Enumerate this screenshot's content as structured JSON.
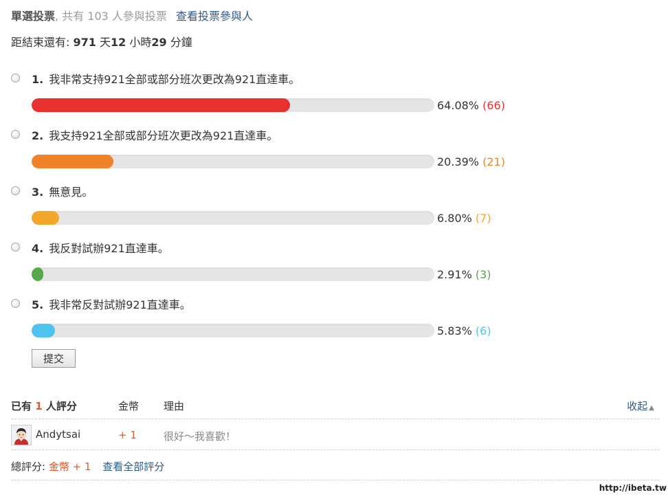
{
  "poll": {
    "type_label": "單選投票",
    "sep": ",",
    "participants_prefix": " 共有 ",
    "participants_count": "103",
    "participants_suffix": " 人參與投票",
    "view_voters_link": "查看投票參與人"
  },
  "countdown": {
    "prefix": "距結束還有: ",
    "days": "971",
    "days_unit": " 天",
    "hours": "12",
    "hours_unit": " 小時",
    "minutes": "29",
    "minutes_unit": " 分鐘"
  },
  "options": [
    {
      "num": "1.",
      "text": "我非常支持921全部或部分班次更改為921直達車。",
      "percent_label": "64.08%",
      "percent": 64.08,
      "votes_label": "(66)",
      "color": "#e8302e"
    },
    {
      "num": "2.",
      "text": "我支持921全部或部分班次更改為921直達車。",
      "percent_label": "20.39%",
      "percent": 20.39,
      "votes_label": "(21)",
      "color": "#f0822a"
    },
    {
      "num": "3.",
      "text": "無意見。",
      "percent_label": "6.80%",
      "percent": 6.8,
      "votes_label": "(7)",
      "color": "#f2a72a"
    },
    {
      "num": "4.",
      "text": "我反對試辦921直達車。",
      "percent_label": "2.91%",
      "percent": 2.91,
      "votes_label": "(3)",
      "color": "#55a84a"
    },
    {
      "num": "5.",
      "text": "我非常反對試辦921直達車。",
      "percent_label": "5.83%",
      "percent": 5.83,
      "votes_label": "(6)",
      "color": "#4ec3ee"
    }
  ],
  "submit_label": "提交",
  "ratings": {
    "header_prefix": "已有 ",
    "header_count": "1",
    "header_suffix": " 人評分",
    "col_coin": "金幣",
    "col_reason": "理由",
    "collapse_label": "收起",
    "rows": [
      {
        "user": "Andytsai",
        "coins": "+ 1",
        "reason": "很好～我喜歡！"
      }
    ],
    "total_label": "總評分: ",
    "total_value": "金幣 + 1",
    "view_all_link": "查看全部評分"
  },
  "watermark": "http://ibeta.tw"
}
